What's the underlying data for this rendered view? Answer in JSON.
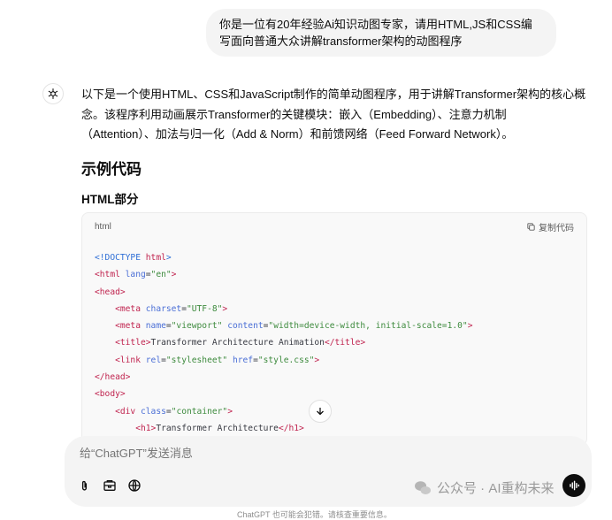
{
  "user_message": "你是一位有20年经验Ai知识动图专家，请用HTML,JS和CSS编写面向普通大众讲解transformer架构的动图程序",
  "assistant": {
    "intro_line1": "以下是一个使用HTML、CSS和JavaScript制作的简单动图程序，用于讲解Transformer架构的核心概",
    "intro_line2": "念。该程序利用动画展示Transformer的关键模块：嵌入（Embedding）、注意力机制",
    "intro_line3": "（Attention）、加法与归一化（Add & Norm）和前馈网络（Feed Forward Network）。",
    "heading": "示例代码",
    "subheading": "HTML部分",
    "code_block": {
      "language": "html",
      "copy_label": "复制代码",
      "lines": [
        {
          "indent": "",
          "parts": [
            [
              "doc",
              "<!DOCTYPE "
            ],
            [
              "tag",
              "html"
            ],
            [
              "doc",
              ">"
            ]
          ]
        },
        {
          "indent": "",
          "parts": [
            [
              "tag",
              "<html "
            ],
            [
              "attr",
              "lang"
            ],
            [
              "plain",
              "="
            ],
            [
              "str",
              "\"en\""
            ],
            [
              "tag",
              ">"
            ]
          ]
        },
        {
          "indent": "",
          "parts": [
            [
              "tag",
              "<head>"
            ]
          ]
        },
        {
          "indent": "    ",
          "parts": [
            [
              "tag",
              "<meta "
            ],
            [
              "attr",
              "charset"
            ],
            [
              "plain",
              "="
            ],
            [
              "str",
              "\"UTF-8\""
            ],
            [
              "tag",
              ">"
            ]
          ]
        },
        {
          "indent": "    ",
          "parts": [
            [
              "tag",
              "<meta "
            ],
            [
              "attr",
              "name"
            ],
            [
              "plain",
              "="
            ],
            [
              "str",
              "\"viewport\""
            ],
            [
              "plain",
              " "
            ],
            [
              "attr",
              "content"
            ],
            [
              "plain",
              "="
            ],
            [
              "str",
              "\"width=device-width, initial-scale=1.0\""
            ],
            [
              "tag",
              ">"
            ]
          ]
        },
        {
          "indent": "    ",
          "parts": [
            [
              "tag",
              "<title>"
            ],
            [
              "plain",
              "Transformer Architecture Animation"
            ],
            [
              "tag",
              "</title>"
            ]
          ]
        },
        {
          "indent": "    ",
          "parts": [
            [
              "tag",
              "<link "
            ],
            [
              "attr",
              "rel"
            ],
            [
              "plain",
              "="
            ],
            [
              "str",
              "\"stylesheet\""
            ],
            [
              "plain",
              " "
            ],
            [
              "attr",
              "href"
            ],
            [
              "plain",
              "="
            ],
            [
              "str",
              "\"style.css\""
            ],
            [
              "tag",
              ">"
            ]
          ]
        },
        {
          "indent": "",
          "parts": [
            [
              "tag",
              "</head>"
            ]
          ]
        },
        {
          "indent": "",
          "parts": [
            [
              "tag",
              "<body>"
            ]
          ]
        },
        {
          "indent": "    ",
          "parts": [
            [
              "tag",
              "<div "
            ],
            [
              "attr",
              "class"
            ],
            [
              "plain",
              "="
            ],
            [
              "str",
              "\"container\""
            ],
            [
              "tag",
              ">"
            ]
          ]
        },
        {
          "indent": "        ",
          "parts": [
            [
              "tag",
              "<h1>"
            ],
            [
              "plain",
              "Transformer Architecture"
            ],
            [
              "tag",
              "</h1>"
            ]
          ]
        }
      ]
    }
  },
  "composer": {
    "placeholder": "给“ChatGPT”发送消息"
  },
  "icons": {
    "attach": "paperclip-icon",
    "tools": "toolbox-icon",
    "web": "globe-icon",
    "voice": "voice-wave-icon",
    "scroll": "arrow-down-icon",
    "copy": "copy-icon",
    "avatar": "openai-logo-icon"
  },
  "watermark": "公众号 · AI重构未来",
  "footer_hint": "ChatGPT 也可能会犯错。请核查重要信息。"
}
